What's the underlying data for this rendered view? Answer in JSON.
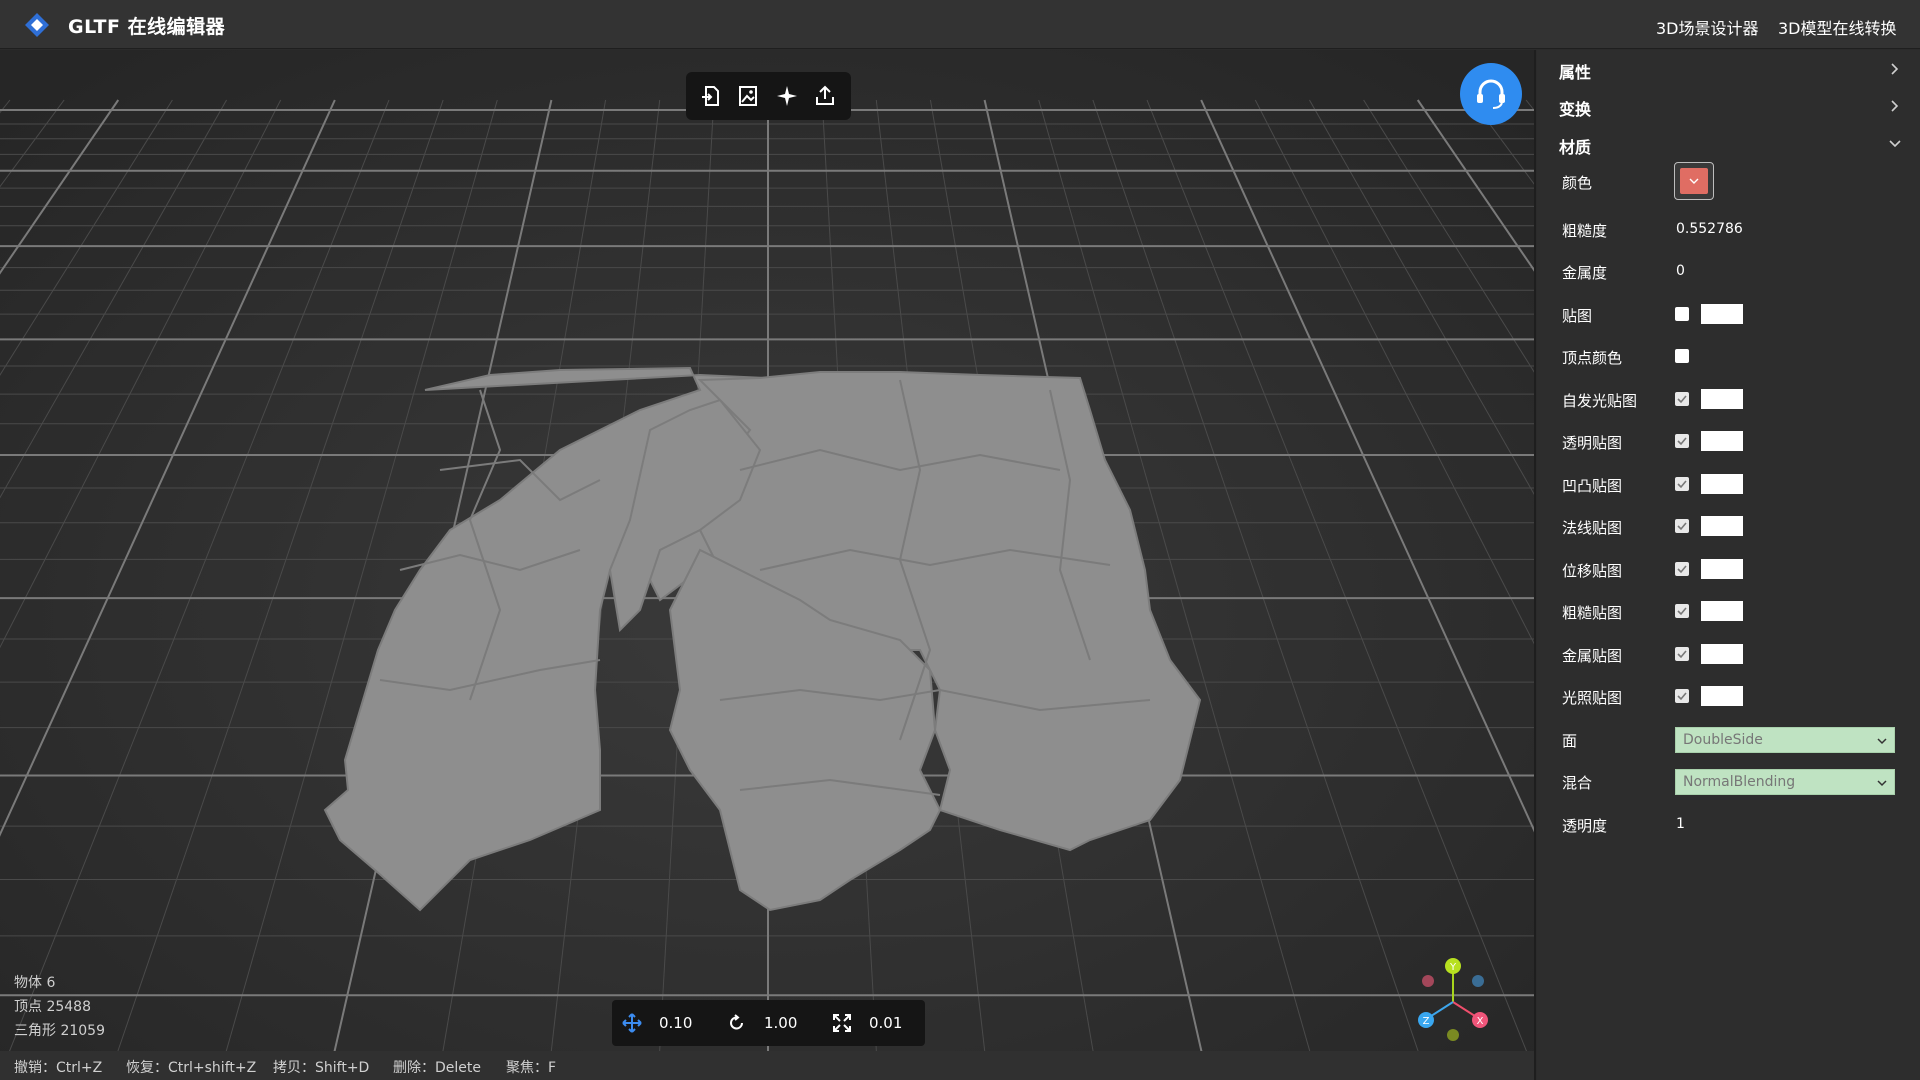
{
  "app": {
    "title": "GLTF 在线编辑器",
    "nav": [
      "3D场景设计器",
      "3D模型在线转换"
    ]
  },
  "viewport": {
    "stats": {
      "objects": "物体 6",
      "vertices": "顶点 25488",
      "triangles": "三角形 21059"
    },
    "transform": {
      "translate": "0.10",
      "rotate": "1.00",
      "scale": "0.01"
    },
    "gizmo_labels": {
      "x": "X",
      "y": "Y",
      "z": "Z"
    },
    "icons": {
      "import": "import-icon",
      "image": "image-export-icon",
      "light": "sparkle-icon",
      "export": "share-icon",
      "support": "headset-icon"
    }
  },
  "shortcuts": [
    "撤销：Ctrl+Z",
    "恢复：Ctrl+shift+Z",
    "拷贝：Shift+D",
    "删除：Delete",
    "聚焦：F"
  ],
  "panel": {
    "sections": [
      {
        "title": "属性",
        "expanded": false
      },
      {
        "title": "变换",
        "expanded": false
      },
      {
        "title": "材质",
        "expanded": true
      }
    ],
    "material": {
      "color_label": "颜色",
      "color_value": "#e06d63",
      "roughness_label": "粗糙度",
      "roughness_value": "0.552786",
      "metalness_label": "金属度",
      "metalness_value": "0",
      "maps": [
        {
          "label": "贴图",
          "checked": false,
          "swatch": true
        },
        {
          "label": "顶点颜色",
          "checked": false,
          "swatch": false
        },
        {
          "label": "自发光贴图",
          "checked": true,
          "swatch": true
        },
        {
          "label": "透明贴图",
          "checked": true,
          "swatch": true
        },
        {
          "label": "凹凸贴图",
          "checked": true,
          "swatch": true
        },
        {
          "label": "法线贴图",
          "checked": true,
          "swatch": true
        },
        {
          "label": "位移贴图",
          "checked": true,
          "swatch": true
        },
        {
          "label": "粗糙贴图",
          "checked": true,
          "swatch": true
        },
        {
          "label": "金属贴图",
          "checked": true,
          "swatch": true
        },
        {
          "label": "光照贴图",
          "checked": true,
          "swatch": true
        }
      ],
      "side_label": "面",
      "side_value": "DoubleSide",
      "blend_label": "混合",
      "blend_value": "NormalBlending",
      "opacity_label": "透明度",
      "opacity_value": "1"
    }
  },
  "colors": {
    "accent": "#2f8cf0",
    "model": "#8e8e8e",
    "select_bg": "#bfe3c2"
  }
}
